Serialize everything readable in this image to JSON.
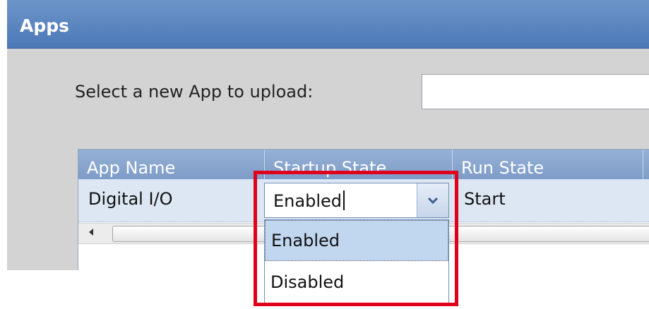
{
  "panel": {
    "title": "Apps"
  },
  "upload": {
    "label": "Select a new App to upload:",
    "value": ""
  },
  "grid": {
    "columns": [
      "App Name",
      "Startup State",
      "Run State"
    ],
    "rows": [
      {
        "app_name": "Digital I/O",
        "startup_state": "Enabled",
        "run_state": "Start"
      }
    ]
  },
  "startup_dropdown": {
    "current_value": "Enabled",
    "options": [
      "Enabled",
      "Disabled"
    ],
    "highlighted_option": "Enabled"
  },
  "icons": {
    "dropdown_arrow": "chevron-down-icon",
    "scroll_left": "scroll-left-icon"
  },
  "colors": {
    "header_blue": "#4b78b6",
    "grid_header_blue": "#7e9cc8",
    "row_background": "#dde7f3",
    "highlight_red": "#e0001b",
    "selected_option": "#c1d6ef"
  }
}
